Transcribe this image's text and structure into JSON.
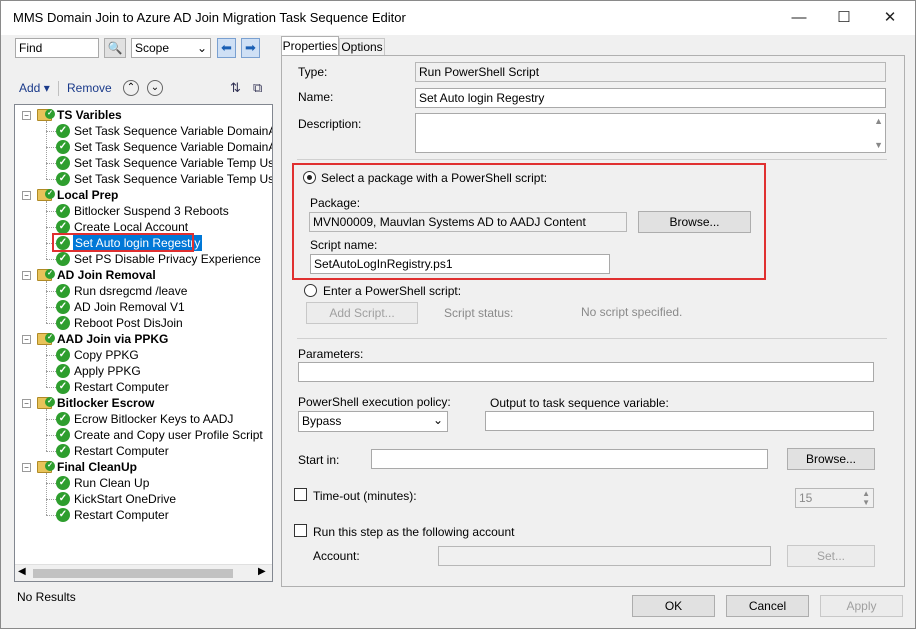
{
  "window": {
    "title": "MMS Domain Join to Azure AD Join Migration Task Sequence Editor",
    "minimize": "—",
    "maximize": "☐",
    "close": "✕"
  },
  "toolbar": {
    "find_value": "Find",
    "scope_label": "Scope",
    "add_label": "Add",
    "remove_label": "Remove"
  },
  "tree": {
    "groups": [
      {
        "label": "TS Varibles",
        "items": [
          "Set Task Sequence Variable DomainAdm",
          "Set Task Sequence Variable DomainAdm",
          "Set Task Sequence Variable Temp User",
          "Set Task Sequence Variable Temp User F"
        ]
      },
      {
        "label": "Local Prep",
        "items": [
          "Bitlocker Suspend 3 Reboots",
          "Create Local Account",
          "Set Auto login Regestry",
          "Set PS Disable Privacy Experience"
        ]
      },
      {
        "label": "AD Join Removal",
        "items": [
          "Run dsregcmd /leave",
          "AD Join Removal V1",
          "Reboot Post DisJoin"
        ]
      },
      {
        "label": "AAD Join via PPKG",
        "items": [
          "Copy PPKG",
          "Apply PPKG",
          "Restart Computer"
        ]
      },
      {
        "label": "Bitlocker Escrow",
        "items": [
          "Ecrow Bitlocker Keys to AADJ",
          "Create and Copy user Profile Script",
          "Restart Computer"
        ]
      },
      {
        "label": "Final CleanUp",
        "items": [
          "Run Clean Up",
          "KickStart OneDrive",
          "Restart Computer"
        ]
      }
    ],
    "selected": "Set Auto login Regestry"
  },
  "status": "No Results",
  "tabs": [
    "Properties",
    "Options"
  ],
  "props": {
    "type_label": "Type:",
    "type_value": "Run PowerShell Script",
    "name_label": "Name:",
    "name_value": "Set Auto login Regestry",
    "desc_label": "Description:",
    "radio_package": "Select a package with a PowerShell script:",
    "package_label": "Package:",
    "package_value": "MVN00009, Mauvlan Systems AD to AADJ Content",
    "browse": "Browse...",
    "script_name_label": "Script name:",
    "script_name_value": "SetAutoLogInRegistry.ps1",
    "radio_enter": "Enter a PowerShell script:",
    "add_script": "Add Script...",
    "script_status_label": "Script status:",
    "script_status_value": "No script specified.",
    "parameters_label": "Parameters:",
    "policy_label": "PowerShell execution policy:",
    "policy_value": "Bypass",
    "output_label": "Output to task sequence variable:",
    "start_in_label": "Start in:",
    "browse2": "Browse...",
    "timeout_label": "Time-out (minutes):",
    "timeout_value": "15",
    "run_as_label": "Run this step as the following account",
    "account_label": "Account:",
    "set_label": "Set..."
  },
  "footer": {
    "ok": "OK",
    "cancel": "Cancel",
    "apply": "Apply"
  },
  "colors": {
    "selection": "#0078d7",
    "highlight_box": "#e03030"
  }
}
